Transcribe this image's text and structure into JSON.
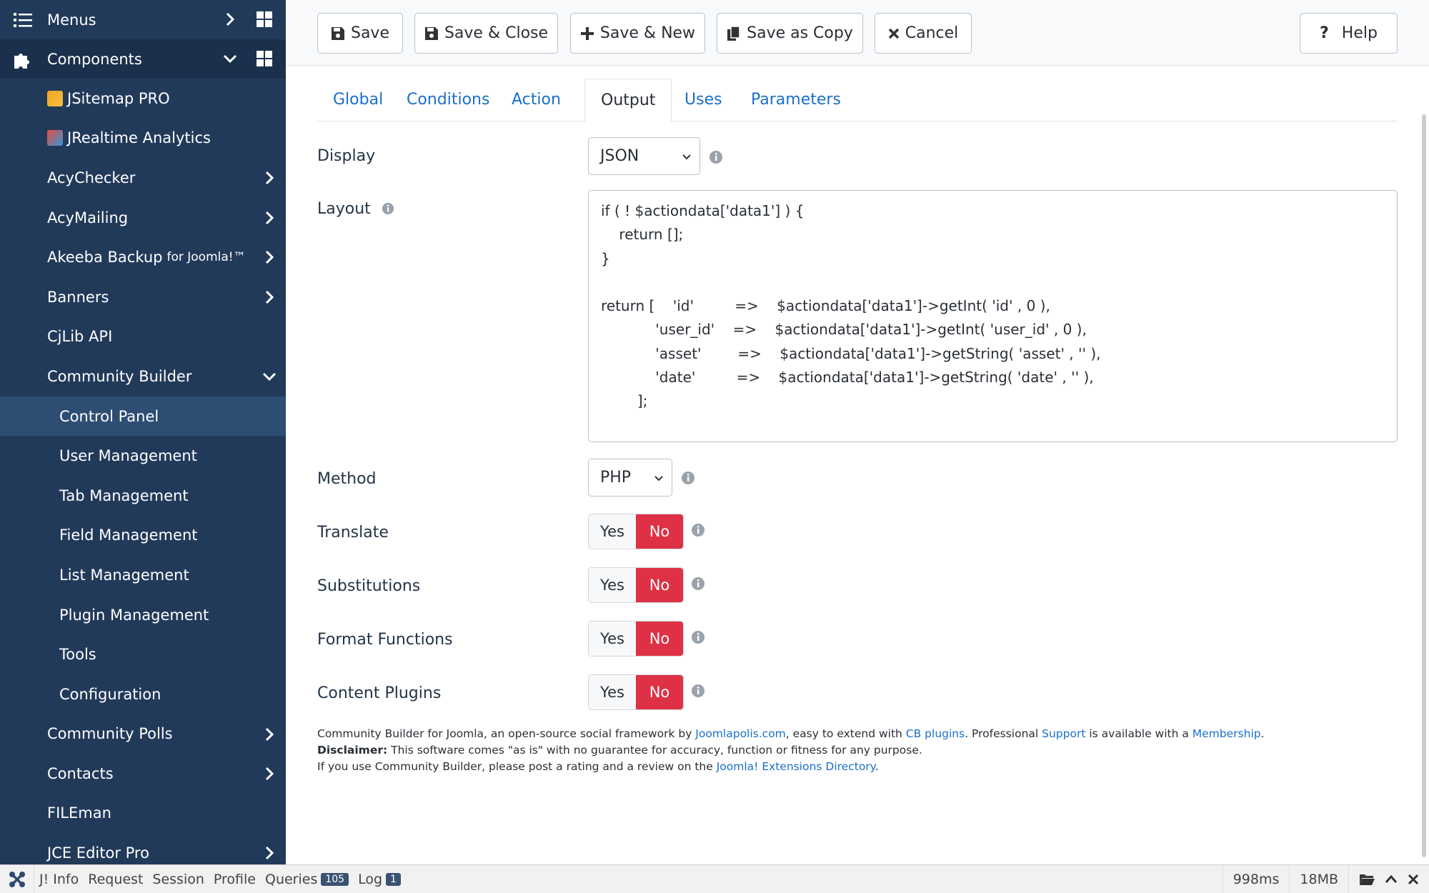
{
  "sidebar": {
    "menus_label": "Menus",
    "components_label": "Components",
    "items": [
      {
        "label": "JSitemap PRO"
      },
      {
        "label": "JRealtime Analytics"
      },
      {
        "label": "AcyChecker"
      },
      {
        "label": "AcyMailing"
      },
      {
        "label": "Akeeba Backup",
        "suffix": "for Joomla!™"
      },
      {
        "label": "Banners"
      },
      {
        "label": "CjLib API"
      },
      {
        "label": "Community Builder"
      }
    ],
    "cb_sub": [
      {
        "label": "Control Panel"
      },
      {
        "label": "User Management"
      },
      {
        "label": "Tab Management"
      },
      {
        "label": "Field Management"
      },
      {
        "label": "List Management"
      },
      {
        "label": "Plugin Management"
      },
      {
        "label": "Tools"
      },
      {
        "label": "Configuration"
      }
    ],
    "after": [
      {
        "label": "Community Polls"
      },
      {
        "label": "Contacts"
      },
      {
        "label": "FILEman"
      },
      {
        "label": "JCE Editor Pro"
      }
    ]
  },
  "toolbar": {
    "save": "Save",
    "save_close": "Save & Close",
    "save_new": "Save & New",
    "save_copy": "Save as Copy",
    "cancel": "Cancel",
    "help": "Help"
  },
  "tabs": [
    "Global",
    "Conditions",
    "Action",
    "Output",
    "Uses",
    "Parameters"
  ],
  "form": {
    "display_label": "Display",
    "display_value": "JSON",
    "layout_label": "Layout",
    "layout_code": "if ( ! $actiondata['data1'] ) {\n    return [];\n}\n\nreturn [    'id'         =>    $actiondata['data1']->getInt( 'id' , 0 ),\n            'user_id'    =>    $actiondata['data1']->getInt( 'user_id' , 0 ),\n            'asset'        =>    $actiondata['data1']->getString( 'asset' , '' ),\n            'date'         =>    $actiondata['data1']->getString( 'date' , '' ),\n        ];",
    "method_label": "Method",
    "method_value": "PHP",
    "translate_label": "Translate",
    "substitutions_label": "Substitutions",
    "format_label": "Format Functions",
    "content_label": "Content Plugins",
    "yes": "Yes",
    "no": "No"
  },
  "footer": {
    "l1_a": "Community Builder for Joomla, an open-source social framework by ",
    "l1_link1": "Joomlapolis.com",
    "l1_b": ", easy to extend with ",
    "l1_link2": "CB plugins",
    "l1_c": ". Professional ",
    "l1_link3": "Support",
    "l1_d": " is available with a ",
    "l1_link4": "Membership",
    "l1_e": ".",
    "l2_bold": "Disclaimer:",
    "l2_text": " This software comes \"as is\" with no guarantee for accuracy, function or fitness for any purpose.",
    "l3_a": "If you use Community Builder, please post a rating and a review on the ",
    "l3_link": "Joomla! Extensions Directory",
    "l3_b": "."
  },
  "debugbar": {
    "info": "J! Info",
    "request": "Request",
    "session": "Session",
    "profile": "Profile",
    "queries": "Queries",
    "queries_count": "105",
    "log": "Log",
    "log_count": "1",
    "time": "998ms",
    "memory": "18MB"
  },
  "colors": {
    "sidebar": "#223a5a",
    "accent": "#1a6fc9",
    "no_active": "#df3146"
  }
}
